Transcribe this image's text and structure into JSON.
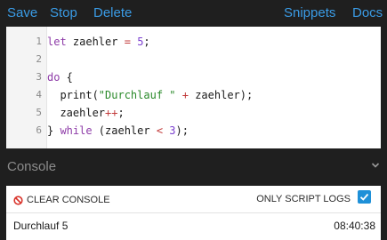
{
  "toolbar": {
    "save_label": "Save",
    "stop_label": "Stop",
    "delete_label": "Delete",
    "snippets_label": "Snippets",
    "docs_label": "Docs",
    "link_color": "#3a9be5"
  },
  "editor": {
    "line_numbers": [
      "1",
      "2",
      "3",
      "4",
      "5",
      "6"
    ],
    "lines": [
      [
        {
          "t": "let",
          "c": "kw"
        },
        {
          "t": " zaehler ",
          "c": ""
        },
        {
          "t": "=",
          "c": "op"
        },
        {
          "t": " ",
          "c": ""
        },
        {
          "t": "5",
          "c": "num"
        },
        {
          "t": ";",
          "c": ""
        }
      ],
      [],
      [
        {
          "t": "do",
          "c": "kw"
        },
        {
          "t": " {",
          "c": ""
        }
      ],
      [
        {
          "t": "  print(",
          "c": ""
        },
        {
          "t": "\"Durchlauf \"",
          "c": "str"
        },
        {
          "t": " ",
          "c": ""
        },
        {
          "t": "+",
          "c": "op"
        },
        {
          "t": " zaehler);",
          "c": ""
        }
      ],
      [
        {
          "t": "  zaehler",
          "c": ""
        },
        {
          "t": "++",
          "c": "op"
        },
        {
          "t": ";",
          "c": ""
        }
      ],
      [
        {
          "t": "} ",
          "c": ""
        },
        {
          "t": "while",
          "c": "kw"
        },
        {
          "t": " (zaehler ",
          "c": ""
        },
        {
          "t": "<",
          "c": "op"
        },
        {
          "t": " ",
          "c": ""
        },
        {
          "t": "3",
          "c": "num"
        },
        {
          "t": ");",
          "c": ""
        }
      ]
    ]
  },
  "console": {
    "title": "Console",
    "collapse_icon": "chevron-down-icon",
    "clear_label": "CLEAR CONSOLE",
    "clear_icon": "no-entry-icon",
    "only_script_logs_label": "ONLY SCRIPT LOGS",
    "only_script_logs_checked": true,
    "entries": [
      {
        "message": "Durchlauf 5",
        "time": "08:40:38"
      }
    ]
  }
}
